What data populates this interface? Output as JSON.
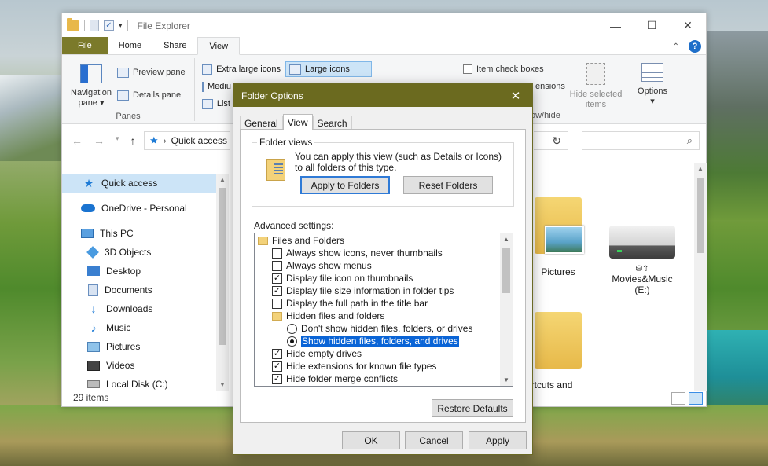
{
  "explorer": {
    "title": "File Explorer",
    "window_controls": [
      "—",
      "☐",
      "✕"
    ],
    "tabs": [
      "File",
      "Home",
      "Share",
      "View"
    ],
    "active_tab": "View",
    "ribbon": {
      "panes": {
        "navigation_pane": "Navigation pane",
        "preview_pane": "Preview pane",
        "details_pane": "Details pane",
        "group_label": "Panes"
      },
      "layout": {
        "extra_large_icons": "Extra large icons",
        "large_icons": "Large icons",
        "medium_icons": "Mediu",
        "list": "List"
      },
      "show_hide": {
        "item_check_boxes": "Item check boxes",
        "file_name_extensions_partial": "ensions",
        "hide_selected_items": "Hide selected items",
        "group_label_partial": "ow/hide"
      },
      "options": "Options"
    },
    "address": {
      "location": "Quick access"
    },
    "nav_items": [
      {
        "label": "Quick access",
        "icon": "star-icon",
        "selected": true
      },
      {
        "label": "OneDrive - Personal",
        "icon": "cloud-icon"
      },
      {
        "label": "This PC",
        "icon": "computer-icon"
      },
      {
        "label": "3D Objects",
        "icon": "cube-icon"
      },
      {
        "label": "Desktop",
        "icon": "desktop-icon"
      },
      {
        "label": "Documents",
        "icon": "documents-icon"
      },
      {
        "label": "Downloads",
        "icon": "download-icon"
      },
      {
        "label": "Music",
        "icon": "music-icon"
      },
      {
        "label": "Pictures",
        "icon": "pictures-icon"
      },
      {
        "label": "Videos",
        "icon": "videos-icon"
      },
      {
        "label": "Local Disk (C:)",
        "icon": "disk-icon"
      }
    ],
    "status": "29 items",
    "tiles": {
      "pictures": "Pictures",
      "movies_drive": "Movies&Music",
      "movies_drive_letter": "(E:)",
      "shortcuts_partial": "ortcuts and"
    }
  },
  "dialog": {
    "title": "Folder Options",
    "tabs": [
      "General",
      "View",
      "Search"
    ],
    "active_tab": "View",
    "folder_views": {
      "legend": "Folder views",
      "text": "You can apply this view (such as Details or Icons) to all folders of this type.",
      "apply_button": "Apply to Folders",
      "reset_button": "Reset Folders"
    },
    "advanced_label": "Advanced settings:",
    "advanced_items": [
      {
        "type": "folder",
        "label": "Files and Folders",
        "indent": 0
      },
      {
        "type": "checkbox",
        "label": "Always show icons, never thumbnails",
        "checked": false,
        "indent": 1
      },
      {
        "type": "checkbox",
        "label": "Always show menus",
        "checked": false,
        "indent": 1
      },
      {
        "type": "checkbox",
        "label": "Display file icon on thumbnails",
        "checked": true,
        "indent": 1
      },
      {
        "type": "checkbox",
        "label": "Display file size information in folder tips",
        "checked": true,
        "indent": 1
      },
      {
        "type": "checkbox",
        "label": "Display the full path in the title bar",
        "checked": false,
        "indent": 1
      },
      {
        "type": "folder",
        "label": "Hidden files and folders",
        "indent": 1
      },
      {
        "type": "radio",
        "label": "Don't show hidden files, folders, or drives",
        "checked": false,
        "indent": 2
      },
      {
        "type": "radio",
        "label": "Show hidden files, folders, and drives",
        "checked": true,
        "indent": 2,
        "highlight": true
      },
      {
        "type": "checkbox",
        "label": "Hide empty drives",
        "checked": true,
        "indent": 1
      },
      {
        "type": "checkbox",
        "label": "Hide extensions for known file types",
        "checked": true,
        "indent": 1
      },
      {
        "type": "checkbox",
        "label": "Hide folder merge conflicts",
        "checked": true,
        "indent": 1
      }
    ],
    "restore_button": "Restore Defaults",
    "ok_button": "OK",
    "cancel_button": "Cancel",
    "apply_button": "Apply"
  }
}
